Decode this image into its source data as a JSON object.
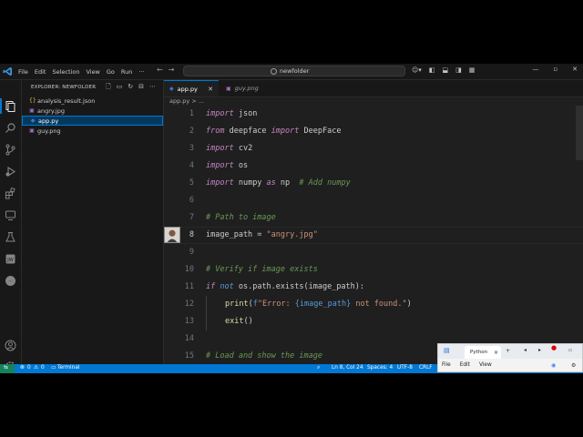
{
  "titlebar": {
    "menu": [
      "File",
      "Edit",
      "Selection",
      "View",
      "Go",
      "Run"
    ],
    "search_text": "newfolder",
    "more": "···"
  },
  "sidebar": {
    "header": "EXPLORER: NEWFOLDER",
    "files": [
      {
        "name": "analysis_result.json",
        "icon": "{}",
        "color": "#cbcb41"
      },
      {
        "name": "angry.jpg",
        "icon": "▣",
        "color": "#a074c4"
      },
      {
        "name": "app.py",
        "icon": "◆",
        "color": "#3b78c9",
        "selected": true
      },
      {
        "name": "guy.png",
        "icon": "▣",
        "color": "#a074c4"
      }
    ]
  },
  "tabs": [
    {
      "label": "app.py",
      "active": true
    },
    {
      "label": "guy.png",
      "active": false
    }
  ],
  "breadcrumb": "app.py > ...",
  "editor": {
    "current_line": 8,
    "lines": [
      {
        "n": "1"
      },
      {
        "n": "2"
      },
      {
        "n": "3"
      },
      {
        "n": "4"
      },
      {
        "n": "5"
      },
      {
        "n": "6"
      },
      {
        "n": "7"
      },
      {
        "n": "8"
      },
      {
        "n": "9"
      },
      {
        "n": "10"
      },
      {
        "n": "11"
      },
      {
        "n": "12"
      },
      {
        "n": "13"
      },
      {
        "n": "14"
      },
      {
        "n": "15"
      }
    ],
    "code": {
      "l1_kw": "import",
      "l1_rest": " json",
      "l2_kw1": "from",
      "l2_mid": " deepface ",
      "l2_kw2": "import",
      "l2_rest": " DeepFace",
      "l3_kw": "import",
      "l3_rest": " cv2",
      "l4_kw": "import",
      "l4_rest": " os",
      "l5_kw": "import",
      "l5_mid": " numpy ",
      "l5_kw2": "as",
      "l5_rest": " np  ",
      "l5_cmt": "# Add numpy",
      "l7_cmt": "# Path to image",
      "l8_var": "image_path",
      "l8_eq": " = ",
      "l8_str": "\"angry.jpg\"",
      "l10_cmt": "# Verify if image exists",
      "l11_kw": "if",
      "l11_kw2": " not",
      "l11_rest": " os.path.exists(image_path):",
      "l12_fn": "print",
      "l12_p": "(",
      "l12_f": "f",
      "l12_str1": "\"Error: ",
      "l12_br": "{image_path}",
      "l12_str2": " not found.\"",
      "l12_end": ")",
      "l13_fn": "exit",
      "l13_rest": "()",
      "l15_cmt": "# Load and show the image"
    }
  },
  "statusbar": {
    "errors": "0",
    "warnings": "0",
    "terminal": "Terminal",
    "position": "Ln 8, Col 24",
    "spaces": "Spaces: 4",
    "encoding": "UTF-8",
    "eol": "CRLF"
  },
  "popup": {
    "tab": "Python",
    "menu": [
      "File",
      "Edit",
      "View"
    ]
  },
  "colors": {
    "accent": "#0078d4",
    "keyword": "#c586c0",
    "string": "#ce9178",
    "comment": "#6a9955"
  }
}
